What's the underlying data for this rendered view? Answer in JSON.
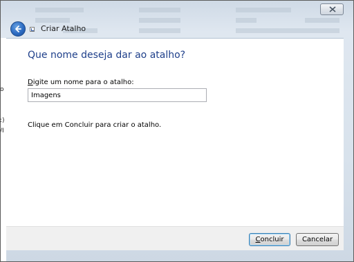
{
  "window": {
    "title": "Criar Atalho",
    "close_icon": "close-icon",
    "back_icon": "back-arrow-icon"
  },
  "content": {
    "heading": "Que nome deseja dar ao atalho?",
    "field_label_access": "D",
    "field_label_rest": "igite um nome para o atalho:",
    "name_value": "Imagens",
    "hint": "Clique em Concluir para criar o atalho."
  },
  "footer": {
    "finish_access": "C",
    "finish_rest": "oncluir",
    "cancel_label": "Cancelar"
  },
  "colors": {
    "heading": "#1e3f8a",
    "chrome": "#d8e2ec",
    "footer": "#f0f0f0"
  }
}
